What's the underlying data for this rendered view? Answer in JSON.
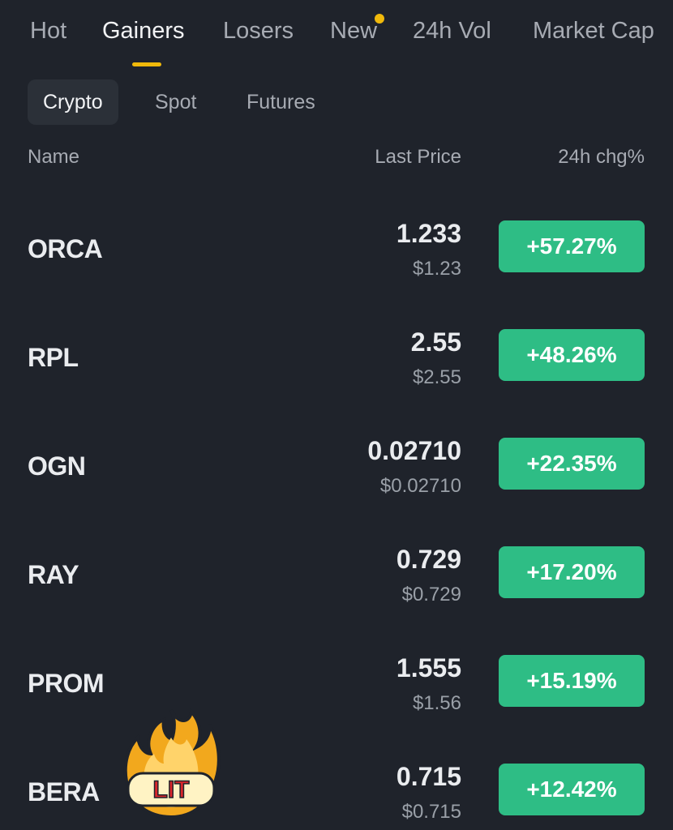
{
  "top_tabs": [
    {
      "label": "Hot"
    },
    {
      "label": "Gainers"
    },
    {
      "label": "Losers"
    },
    {
      "label": "New"
    },
    {
      "label": "24h Vol"
    },
    {
      "label": "Market Cap"
    }
  ],
  "active_top_tab": "Gainers",
  "sub_tabs": [
    {
      "label": "Crypto"
    },
    {
      "label": "Spot"
    },
    {
      "label": "Futures"
    }
  ],
  "active_sub_tab": "Crypto",
  "columns": {
    "name": "Name",
    "last_price": "Last Price",
    "change": "24h chg%"
  },
  "rows": [
    {
      "symbol": "ORCA",
      "price": "1.233",
      "usd": "$1.23",
      "change": "+57.27%"
    },
    {
      "symbol": "RPL",
      "price": "2.55",
      "usd": "$2.55",
      "change": "+48.26%"
    },
    {
      "symbol": "OGN",
      "price": "0.02710",
      "usd": "$0.02710",
      "change": "+22.35%"
    },
    {
      "symbol": "RAY",
      "price": "0.729",
      "usd": "$0.729",
      "change": "+17.20%"
    },
    {
      "symbol": "PROM",
      "price": "1.555",
      "usd": "$1.56",
      "change": "+15.19%"
    },
    {
      "symbol": "BERA",
      "price": "0.715",
      "usd": "$0.715",
      "change": "+12.42%"
    }
  ],
  "sticker": {
    "text": "LIT",
    "icon": "flame-icon"
  },
  "colors": {
    "background": "#1f232b",
    "accent": "#f0b90b",
    "positive": "#2ebd85",
    "muted_text": "#a7abb3"
  }
}
